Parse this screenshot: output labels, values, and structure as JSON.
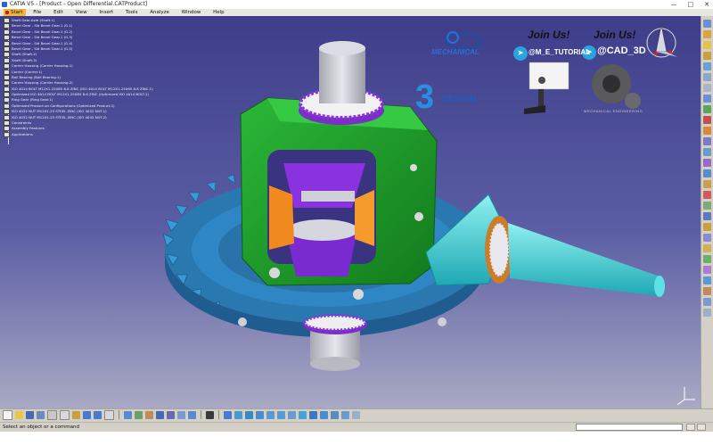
{
  "window": {
    "title": "CATIA V5 - [Product - Open Differential.CATProduct]"
  },
  "menu": [
    "Start",
    "File",
    "Edit",
    "View",
    "Insert",
    "Tools",
    "Analyze",
    "Window",
    "Help"
  ],
  "tree": [
    "Shaft Gear-Axle (Shaft.1)",
    "Bevel Gear - Sid Bevel Gear.1 (G.1)",
    "Bevel Gear - Sid Bevel Gear.1 (G.2)",
    "Bevel Gear - Sid Bevel Gear.1 (G.3)",
    "Bevel Gear - Sid Bevel Gear.1 (G.4)",
    "Bevel Gear - Sid Bevel Gear.1 (G.5)",
    "Shaft (Shaft.2)",
    "Shaft (Shaft.3)",
    "Carrier Housing (Carrier Housing.1)",
    "Carrier (Carrier.1)",
    "Ball Bearing (Ball Bearing.1)",
    "Carrier Housing (Carrier Housing.2)",
    "ISO 4014 BOLT M12X1.25X65 8.8 ZINC (ISO 4014 BOLT M12X1.25X65 8.8 ZINC.1)",
    "Optimized ISO 4014 BOLT M12X1.25X65 8.8 ZINC (Optimized ISO 4014 BOLT.1)",
    "Ring Gear (Ring Gear.1)",
    "Optimized Product on Configurations (Optimized Product.1)",
    "ISO 4032 NUT M12X1.25 STEEL ZINC (ISO 4032 NUT.1)",
    "ISO 4032 NUT M12X1.25 STEEL ZINC (ISO 4032 NUT.2)",
    "Constraints",
    "Assembly Features",
    "Applications"
  ],
  "watermarks": {
    "mechanical_logo_text": "MECHANICAL",
    "join_us_1": "Join Us!",
    "join_us_2": "Join Us!",
    "handle_1": "@M_E_TUTORIAL",
    "handle_2": "@CAD_3D",
    "ds_logo_numeral": "3",
    "ds_logo_word": "DESIGN",
    "mechanical_small": "MECHANICAL ENGINEERING"
  },
  "status": {
    "message": "Select an object or a command"
  },
  "colors": {
    "viewport_top": "#3e3d8a",
    "viewport_bottom": "#a9a9c4",
    "housing_green": "#1f9a2a",
    "ring_gear_blue": "#2f86c4",
    "pinion_cyan": "#2fd4d4",
    "side_gear_purple": "#8a32e0",
    "spider_orange": "#f08a1e",
    "shaft_silver": "#cfcfd6",
    "bearing_white": "#eeeeee"
  },
  "icons": {
    "telegram": "telegram-icon",
    "compass": "compass-icon"
  }
}
